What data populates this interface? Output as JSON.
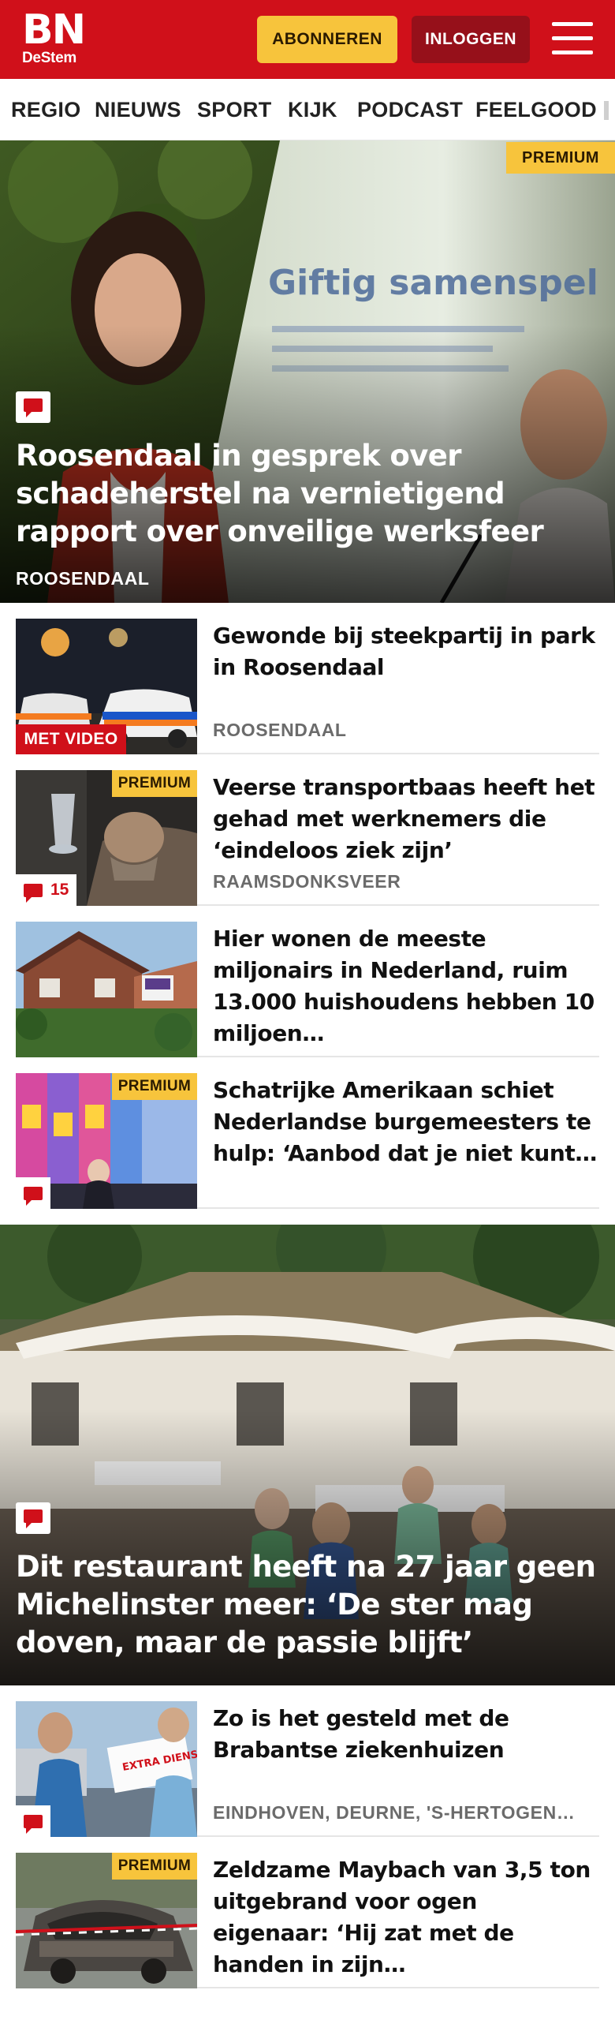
{
  "brand": {
    "name": "BN",
    "sub": "DeStem",
    "color": "#d0101a",
    "accent": "#f7c43c"
  },
  "header": {
    "subscribe_label": "ABONNEREN",
    "login_label": "INLOGGEN",
    "menu_icon": "hamburger-icon"
  },
  "nav": {
    "items": [
      "REGIO",
      "NIEUWS",
      "SPORT",
      "KIJK",
      "PODCAST",
      "FEELGOOD"
    ]
  },
  "hero1": {
    "premium": "PREMIUM",
    "title": "Roosendaal in gesprek over schadeherstel na vernietigend rapport over onveilige werksfeer",
    "region": "ROOSENDAAL",
    "slide_text": "Giftig samenspel"
  },
  "articles": [
    {
      "title": "Gewonde bij steekpartij in park in Roosendaal",
      "region": "ROOSENDAAL",
      "video": "MET VIDEO"
    },
    {
      "title": "Veerse transportbaas heeft het gehad met werknemers die ‘eindeloos ziek zijn’",
      "region": "RAAMSDONKSVEER",
      "premium": "PREMIUM",
      "comments": "15"
    },
    {
      "title": "Hier wonen de meeste miljonairs in Nederland, ruim 13.000 huishoudens hebben 10 miljoen…"
    },
    {
      "title": "Schatrijke Amerikaan schiet Nederlandse burgemeesters te hulp: ‘Aanbod dat je niet kunt…",
      "premium": "PREMIUM"
    }
  ],
  "hero2": {
    "title": "Dit restaurant heeft na 27 jaar geen Michelinster meer: ‘De ster mag doven, maar de passie blijft’"
  },
  "articles2": [
    {
      "title": "Zo is het gesteld met de Brabantse ziekenhuizen",
      "region": "EINDHOVEN, DEURNE, 'S-HERTOGEN…",
      "sign_text": "EXTRA DIENST NIET BELLEN"
    },
    {
      "title": "Zeldzame Maybach van 3,5 ton uitgebrand voor ogen eigenaar: ‘Hij zat met de handen in zijn…",
      "premium": "PREMIUM"
    }
  ]
}
